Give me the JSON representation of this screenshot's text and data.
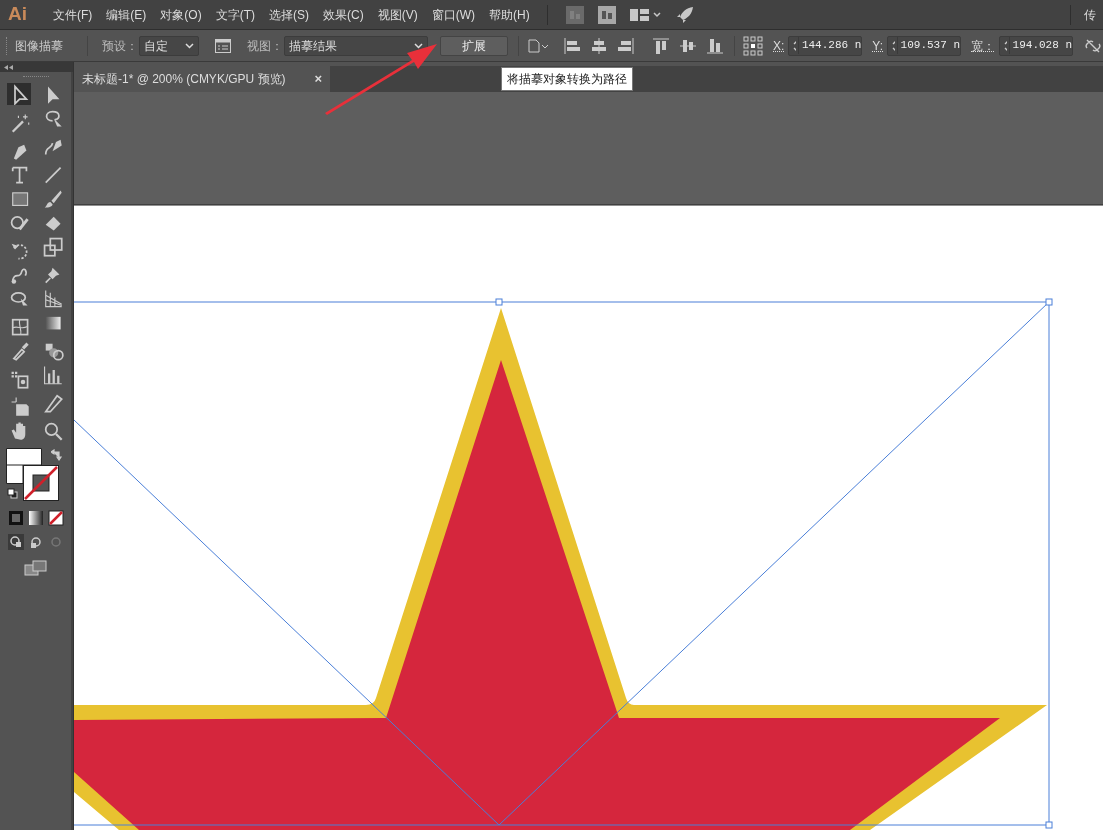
{
  "app_logo": "Ai",
  "menu": [
    "文件(F)",
    "编辑(E)",
    "对象(O)",
    "文字(T)",
    "选择(S)",
    "效果(C)",
    "视图(V)",
    "窗口(W)",
    "帮助(H)"
  ],
  "workspace": "传",
  "control_bar": {
    "panel_label": "图像描摹",
    "preset_label": "预设：",
    "preset_value": "自定",
    "view_label": "视图：",
    "view_value": "描摹结果",
    "expand_button": "扩展",
    "fields": [
      {
        "label": "X:",
        "value": "144.286 n"
      },
      {
        "label": "Y:",
        "value": "109.537 n"
      },
      {
        "label": "宽：",
        "value": "194.028 n"
      }
    ]
  },
  "tooltip": "将描摹对象转换为路径",
  "document_tab": {
    "title": "未标题-1* @ 200% (CMYK/GPU 预览)",
    "close": "×"
  },
  "tools": [
    {
      "selected": true
    },
    {
      "selected": false
    },
    {
      "selected": false
    },
    {
      "selected": false
    },
    {
      "selected": false
    },
    {
      "selected": false
    },
    {
      "selected": false
    },
    {
      "selected": false
    },
    {
      "selected": false
    },
    {
      "selected": false
    },
    {
      "selected": false
    },
    {
      "selected": false
    },
    {
      "selected": false
    },
    {
      "selected": false
    },
    {
      "selected": false
    },
    {
      "selected": false
    },
    {
      "selected": false
    },
    {
      "selected": false
    },
    {
      "selected": false
    },
    {
      "selected": false
    },
    {
      "selected": false
    },
    {
      "selected": false
    },
    {
      "selected": false
    },
    {
      "selected": false
    },
    {
      "selected": false
    },
    {
      "selected": false
    },
    {
      "selected": false
    },
    {
      "selected": false
    }
  ]
}
